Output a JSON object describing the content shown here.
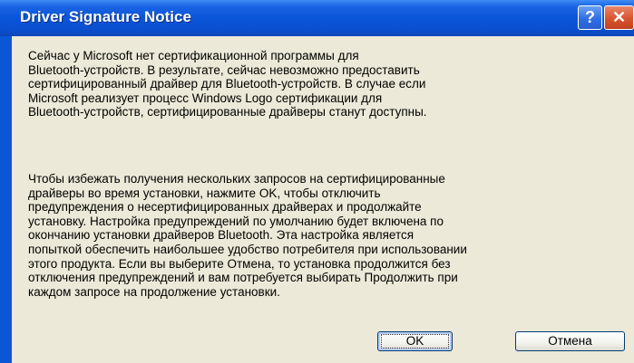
{
  "dialog": {
    "title": "Driver Signature Notice",
    "help_glyph": "?",
    "close_glyph": "✕",
    "paragraph1": "Сейчас у Microsoft нет сертификационной программы для\nBluetooth-устройств. В результате, сейчас невозможно предоставить\nсертифицированный драйвер для Bluetooth-устройств. В случае если\nMicrosoft реализует процесс Windows Logo сертификации для\nBluetooth-устройств, сертифицированные драйверы станут доступны.",
    "paragraph2": "Чтобы избежать получения нескольких запросов на сертифицированные\nдрайверы во время установки, нажмите OK, чтобы отключить\nпредупреждения о несертифицированных драйверах и продолжайте\nустановку. Настройка предупреждений по умолчанию будет включена по\nокончанию установки драйверов Bluetooth. Эта настройка является\nпопыткой обеспечить наибольшее удобство потребителя при использовании\nэтого продукта. Если вы выберите Отмена, то установка продолжится без\nотключения предупреждений и вам потребуется выбирать Продолжить при\nкаждом запросе на продолжение установки.",
    "ok_label": "OK",
    "cancel_label": "Отмена"
  },
  "colors": {
    "titlebar": "#0a55d8",
    "client_background": "#ece9d8",
    "close_button": "#d9532f"
  }
}
